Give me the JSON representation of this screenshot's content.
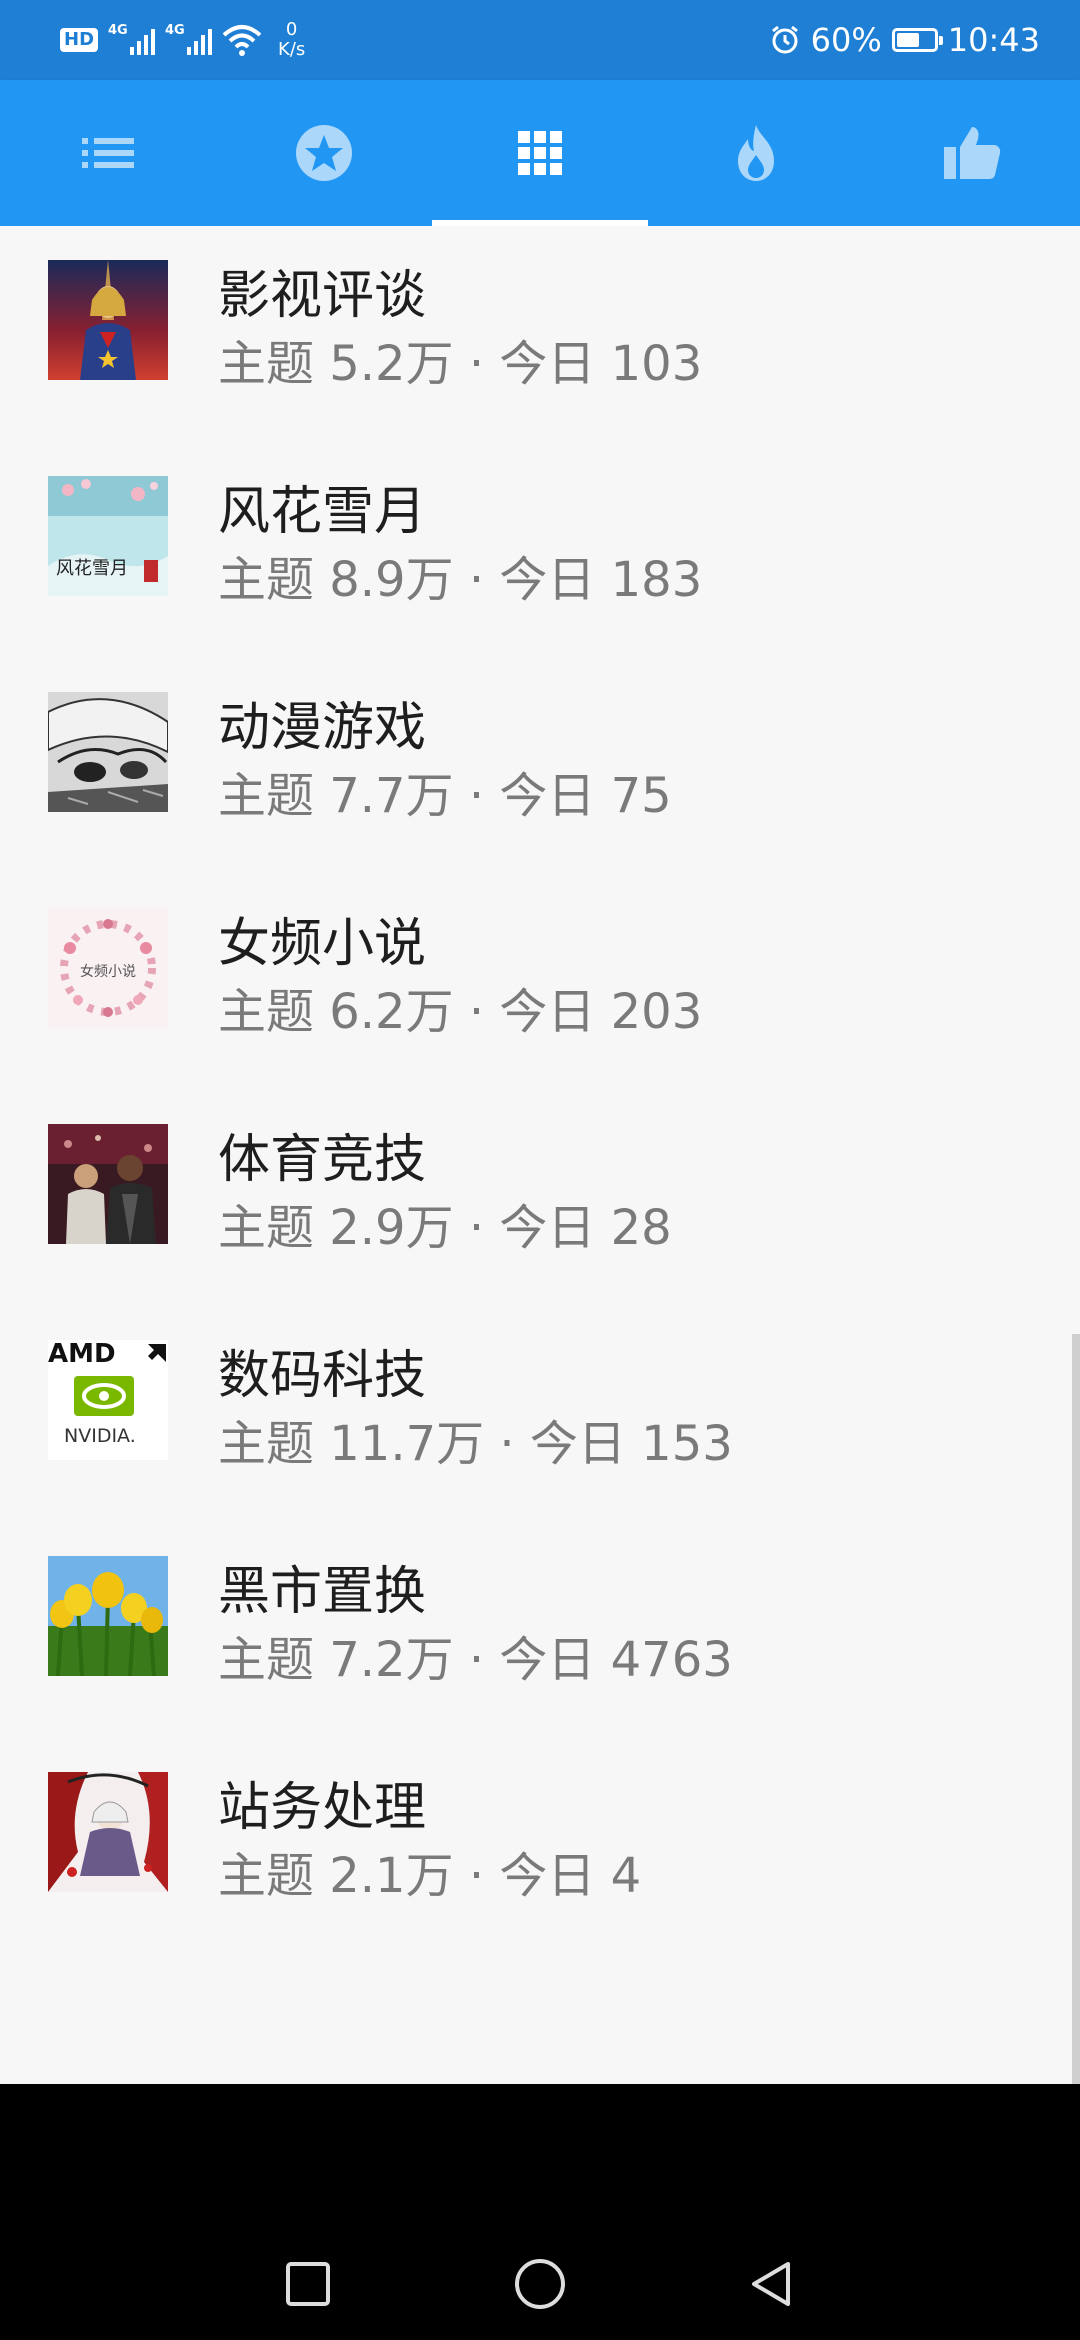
{
  "status_bar": {
    "hd": "HD",
    "network1": "4G",
    "network2": "4G",
    "speed_value": "0",
    "speed_unit": "K/s",
    "battery_text": "60%",
    "battery_level": 0.6,
    "time": "10:43"
  },
  "tabs": [
    {
      "icon": "list-icon",
      "active": false
    },
    {
      "icon": "star-icon",
      "active": false
    },
    {
      "icon": "grid-icon",
      "active": true
    },
    {
      "icon": "fire-icon",
      "active": false
    },
    {
      "icon": "thumb-up-icon",
      "active": false
    }
  ],
  "forums": [
    {
      "title": "影视评谈",
      "meta": "主题 5.2万 · 今日 103",
      "thumb": "movie-poster-thumbnail"
    },
    {
      "title": "风花雪月",
      "meta": "主题 8.9万 · 今日 183",
      "thumb": "calligraphy-thumbnail",
      "thumb_text": "风花雪月"
    },
    {
      "title": "动漫游戏",
      "meta": "主题 7.7万 · 今日 75",
      "thumb": "manga-thumbnail"
    },
    {
      "title": "女频小说",
      "meta": "主题 6.2万 · 今日 203",
      "thumb": "floral-wreath-thumbnail",
      "thumb_text": "女频小说"
    },
    {
      "title": "体育竞技",
      "meta": "主题 2.9万 · 今日 28",
      "thumb": "sports-photo-thumbnail"
    },
    {
      "title": "数码科技",
      "meta": "主题 11.7万 · 今日 153",
      "thumb": "amd-nvidia-thumbnail",
      "thumb_text_1": "AMD",
      "thumb_text_2": "NVIDIA."
    },
    {
      "title": "黑市置换",
      "meta": "主题 7.2万 · 今日 4763",
      "thumb": "tulips-thumbnail"
    },
    {
      "title": "站务处理",
      "meta": "主题 2.1万 · 今日 4",
      "thumb": "anime-character-thumbnail"
    }
  ],
  "colors": {
    "status_bar": "#1f7fd4",
    "tab_bar": "#2196f3",
    "title_text": "#1e1e1e",
    "meta_text": "#7a7a7a",
    "background": "#f7f7f7"
  },
  "nav_buttons": [
    "recent-apps-icon",
    "home-icon",
    "back-icon"
  ]
}
